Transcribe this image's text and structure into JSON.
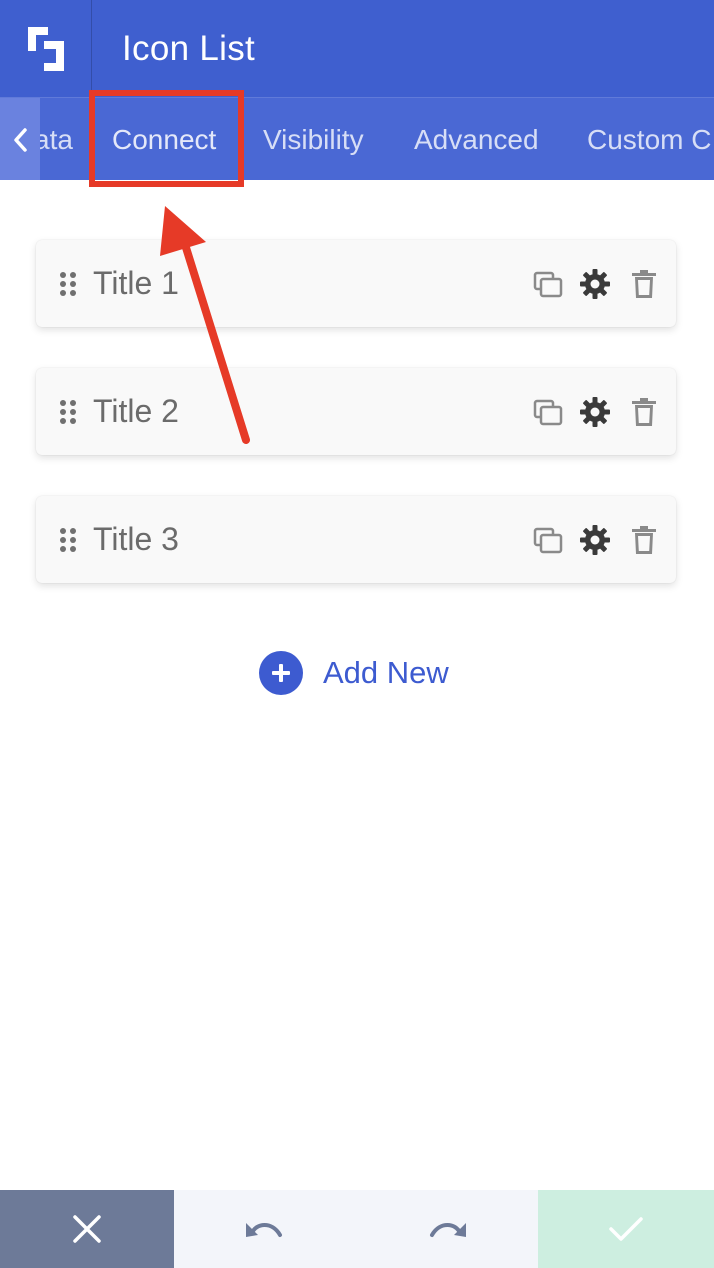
{
  "header": {
    "title": "Icon List",
    "logo_icon": "brand-logo-icon",
    "background": "#3f5fcf"
  },
  "tabs": {
    "items": [
      {
        "label": "ata"
      },
      {
        "label": "Connect"
      },
      {
        "label": "Visibility"
      },
      {
        "label": "Advanced"
      },
      {
        "label": "Custom C"
      }
    ],
    "active": "Connect"
  },
  "list": {
    "items": [
      {
        "title": "Title 1"
      },
      {
        "title": "Title 2"
      },
      {
        "title": "Title 3"
      }
    ],
    "item_icons": [
      "drag-handle-icon",
      "duplicate-icon",
      "gear-icon",
      "trash-icon"
    ]
  },
  "add_new": {
    "label": "Add New",
    "accent": "#3d5bd0"
  },
  "footer": {
    "close_icon": "close-icon",
    "undo_icon": "undo-icon",
    "redo_icon": "redo-icon",
    "save_icon": "checkmark-icon"
  },
  "annotation": {
    "color": "#e63a27"
  }
}
